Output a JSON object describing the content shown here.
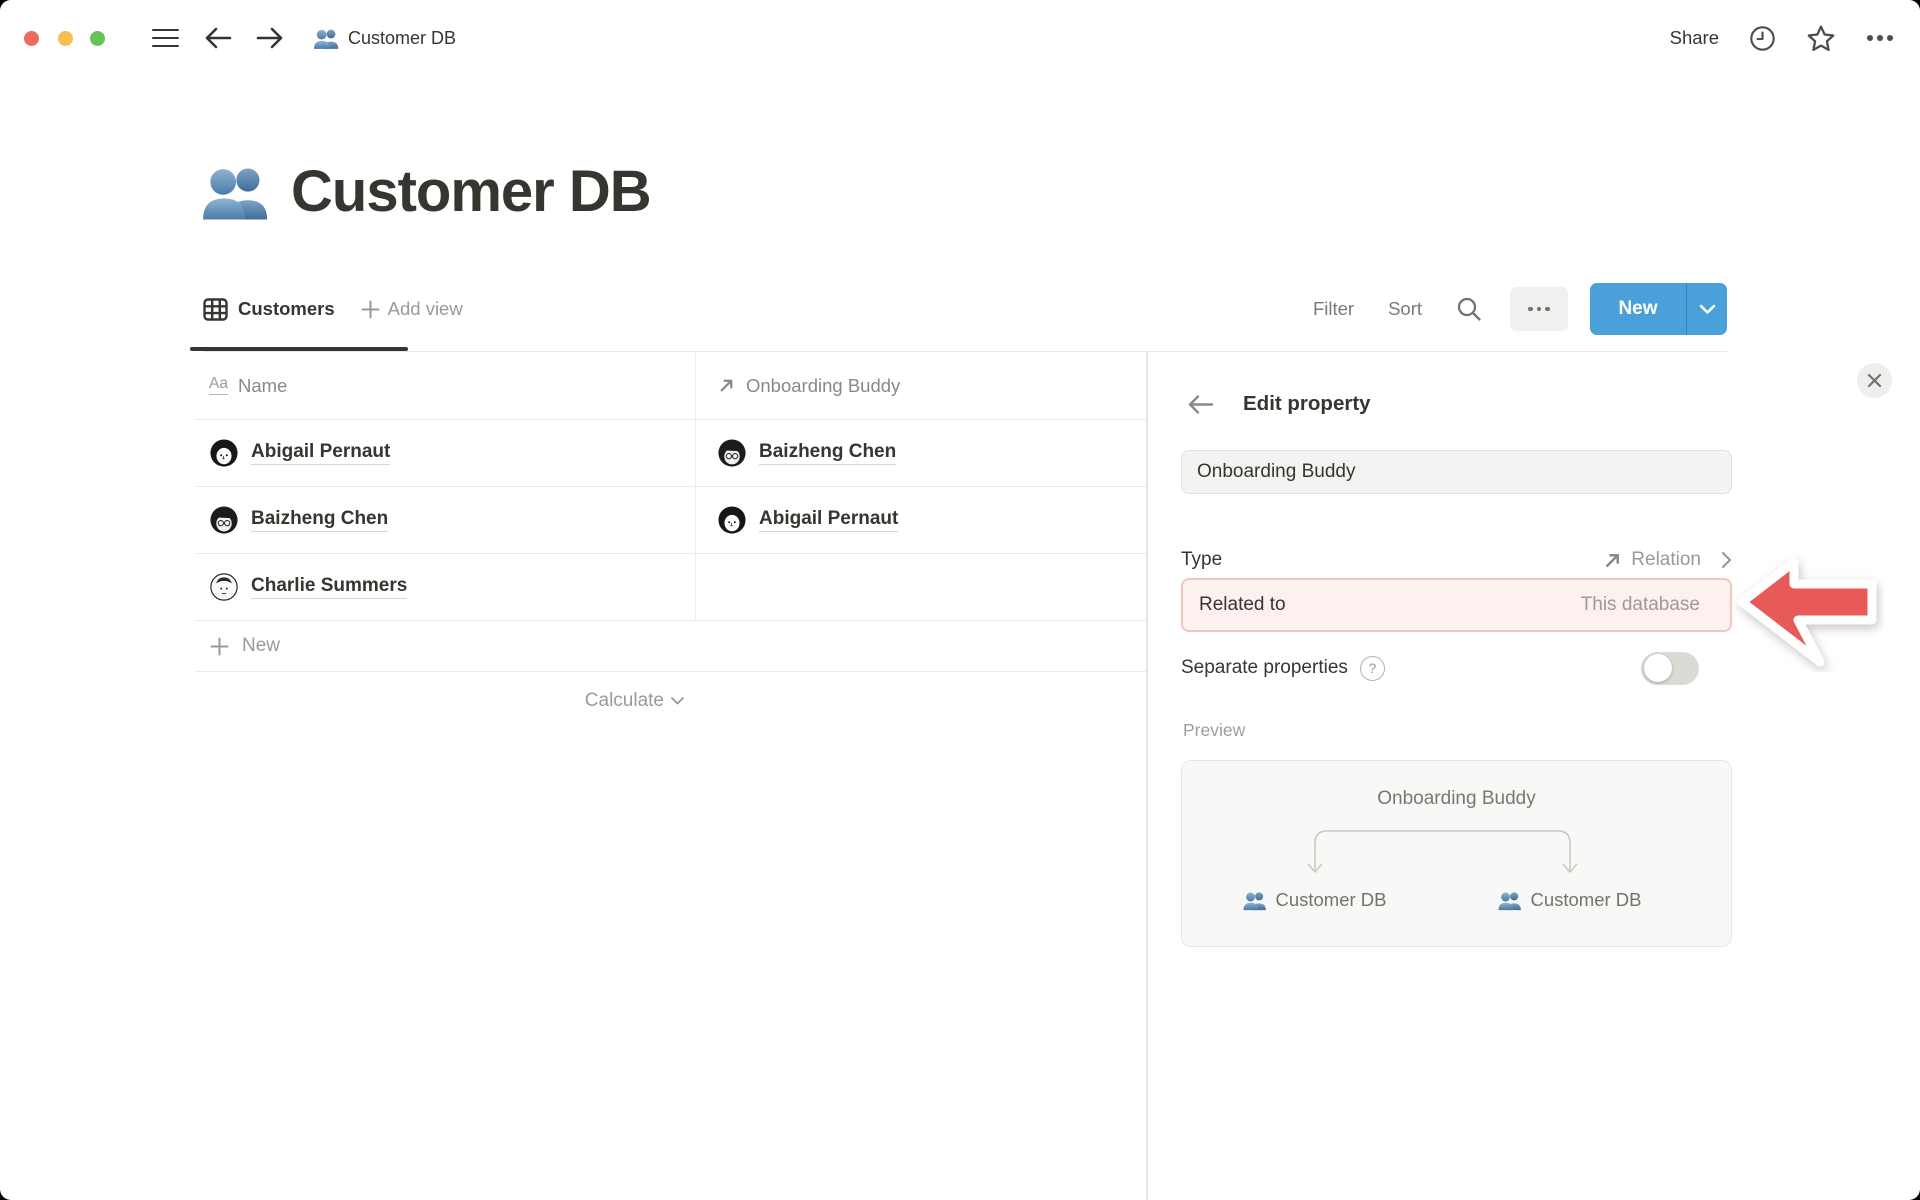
{
  "titlebar": {
    "breadcrumb_label": "Customer DB",
    "share_label": "Share"
  },
  "page": {
    "title": "Customer DB"
  },
  "toolbar": {
    "tab_label": "Customers",
    "add_view_label": "Add view",
    "filter_label": "Filter",
    "sort_label": "Sort",
    "new_label": "New"
  },
  "table": {
    "aa_icon_label": "Aa",
    "columns": [
      {
        "label": "Name"
      },
      {
        "label": "Onboarding Buddy"
      }
    ],
    "rows": [
      {
        "name": "Abigail Pernaut",
        "buddy": "Baizheng Chen"
      },
      {
        "name": "Baizheng Chen",
        "buddy": "Abigail Pernaut"
      },
      {
        "name": "Charlie Summers",
        "buddy": ""
      }
    ],
    "new_row_label": "New",
    "calculate_label": "Calculate"
  },
  "panel": {
    "title": "Edit property",
    "name_field_value": "Onboarding Buddy",
    "type_label": "Type",
    "type_value": "Relation",
    "related_label": "Related to",
    "related_value": "This database",
    "separate_label": "Separate properties",
    "help_glyph": "?",
    "preview_label": "Preview",
    "preview": {
      "property": "Onboarding Buddy",
      "left_db": "Customer DB",
      "right_db": "Customer DB"
    }
  },
  "colors": {
    "accent_blue": "#4aa0d9",
    "highlight_bg": "#fdf1f0",
    "highlight_border": "#f3c5c1",
    "arrow_red": "#e8595a",
    "text_dark": "#37352f",
    "text_gray": "#9b9a97"
  }
}
